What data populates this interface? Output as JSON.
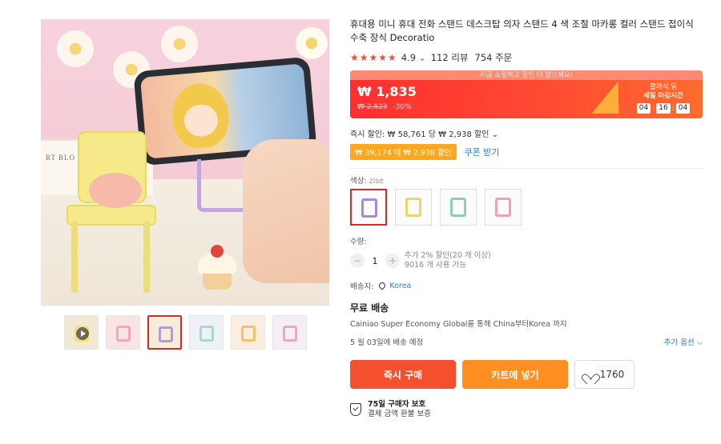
{
  "product": {
    "title": "휴대용 미니 휴대 전화 스탠드 데스크탑 의자 스탠드 4 색 조절 마카롱 컬러 스탠드 접이식 수축 장식 Decoratio",
    "rating": "4.9",
    "reviews": "112 리뷰",
    "orders": "754 주문",
    "stars": "★★★★★"
  },
  "gallery": {
    "book_text": "RT BLO",
    "thumbnails": [
      {
        "label": "video",
        "bg": "#f3e9d2",
        "stand": "#f2e27d"
      },
      {
        "label": "pink",
        "bg": "#f9e4e4",
        "stand": "#f2a9b7"
      },
      {
        "label": "purple",
        "bg": "#f7ecd9",
        "stand": "#b59ad8"
      },
      {
        "label": "multi",
        "bg": "#eef2f8",
        "stand": "#a9d9c7"
      },
      {
        "label": "rainbow",
        "bg": "#fbeee0",
        "stand": "#f5c16a"
      },
      {
        "label": "pastel",
        "bg": "#f6eef6",
        "stand": "#e7a9c5"
      }
    ]
  },
  "price": {
    "promo_banner": "지금 쇼핑하고 할인 더 받으세요!",
    "current": "₩ 1,835",
    "original": "₩ 2,623",
    "discount": "-30%",
    "sale_line1": "클레식 딜",
    "sale_line2": "세일 마감시간",
    "timer": [
      "04",
      "16",
      "04"
    ]
  },
  "discounts": {
    "instant": "즉시 할인: ₩ 58,761 당 ₩ 2,938 할인",
    "chevron": "⌄",
    "coupon_tag": "₩ 39,174 에 ₩ 2,938 할인",
    "coupon_link": "쿠폰 받기"
  },
  "options": {
    "color_label": "색상:",
    "color_value": "zise",
    "swatches": [
      {
        "name": "purple",
        "color": "#a88ad3",
        "active": true
      },
      {
        "name": "yellow",
        "color": "#e8d86a",
        "active": false
      },
      {
        "name": "green",
        "color": "#8fd0a9",
        "active": false
      },
      {
        "name": "pink",
        "color": "#e9a3b3",
        "active": false
      }
    ]
  },
  "quantity": {
    "label": "수량:",
    "minus": "−",
    "value": "1",
    "plus": "+",
    "note1": "추가 2% 할인(20 개 이상)",
    "note2": "9016 개 사용 가능"
  },
  "shipping": {
    "label": "배송지:",
    "location": "Korea",
    "free": "무료 배송",
    "desc": "Cainiao Super Economy Global를 통해 China부터Korea 까지",
    "eta": "5 월 03일에 배송 예정",
    "more": "추가 옵션 ⌵"
  },
  "actions": {
    "buy": "즉시 구매",
    "cart": "카트에 넣기",
    "wish_count": "1760"
  },
  "protection": {
    "line1": "75일 구매자 보호",
    "line2": "결제 금액 환불 보증"
  }
}
